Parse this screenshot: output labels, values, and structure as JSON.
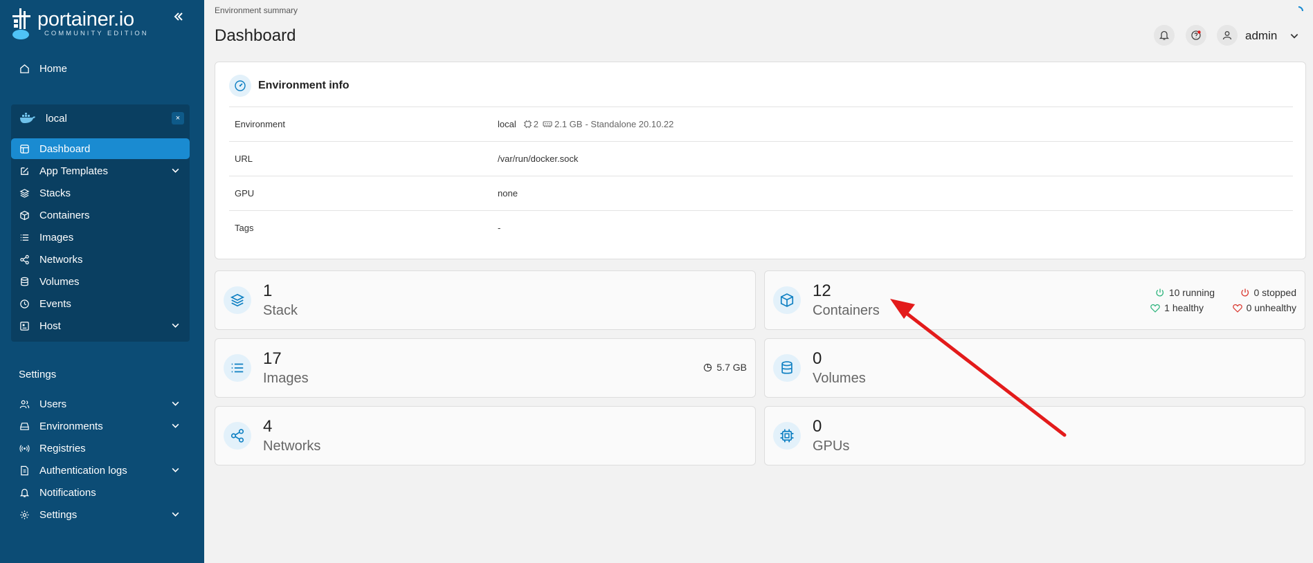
{
  "brand": {
    "name": "portainer.io",
    "edition": "COMMUNITY EDITION"
  },
  "sidebar": {
    "home_label": "Home",
    "environment": {
      "name": "local",
      "close": "×",
      "items": [
        {
          "label": "Dashboard",
          "icon": "dashboard-icon",
          "active": true
        },
        {
          "label": "App Templates",
          "icon": "edit-icon",
          "expandable": true
        },
        {
          "label": "Stacks",
          "icon": "layers-icon"
        },
        {
          "label": "Containers",
          "icon": "box-icon"
        },
        {
          "label": "Images",
          "icon": "list-icon"
        },
        {
          "label": "Networks",
          "icon": "share-icon"
        },
        {
          "label": "Volumes",
          "icon": "database-icon"
        },
        {
          "label": "Events",
          "icon": "clock-icon"
        },
        {
          "label": "Host",
          "icon": "host-icon",
          "expandable": true
        }
      ]
    },
    "settings_title": "Settings",
    "settings_items": [
      {
        "label": "Users",
        "icon": "users-icon",
        "expandable": true
      },
      {
        "label": "Environments",
        "icon": "environments-icon",
        "expandable": true
      },
      {
        "label": "Registries",
        "icon": "radio-icon"
      },
      {
        "label": "Authentication logs",
        "icon": "file-icon",
        "expandable": true
      },
      {
        "label": "Notifications",
        "icon": "bell-icon"
      },
      {
        "label": "Settings",
        "icon": "gear-icon",
        "expandable": true
      }
    ]
  },
  "header": {
    "breadcrumb": "Environment summary",
    "title": "Dashboard",
    "user": "admin"
  },
  "env_info": {
    "title": "Environment info",
    "rows": [
      {
        "key": "Environment",
        "name": "local",
        "cpu": "2",
        "memory": "2.1 GB",
        "detail": "- Standalone 20.10.22"
      },
      {
        "key": "URL",
        "value": "/var/run/docker.sock"
      },
      {
        "key": "GPU",
        "value": "none"
      },
      {
        "key": "Tags",
        "value": "-"
      }
    ]
  },
  "stats": {
    "stack": {
      "count": "1",
      "label": "Stack"
    },
    "containers": {
      "count": "12",
      "label": "Containers",
      "running": "10 running",
      "stopped": "0 stopped",
      "healthy": "1 healthy",
      "unhealthy": "0 unhealthy"
    },
    "images": {
      "count": "17",
      "label": "Images",
      "size": "5.7 GB"
    },
    "volumes": {
      "count": "0",
      "label": "Volumes"
    },
    "networks": {
      "count": "4",
      "label": "Networks"
    },
    "gpus": {
      "count": "0",
      "label": "GPUs"
    }
  },
  "colors": {
    "sidebar": "#0c4c75",
    "active": "#1a8bd1",
    "accent": "#0d7fc2",
    "running": "#2ab37a",
    "stopped": "#d9342b",
    "annotation_arrow": "#e31b1b"
  }
}
